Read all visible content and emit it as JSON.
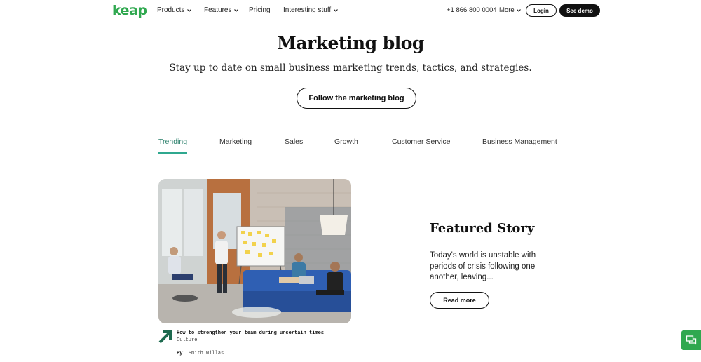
{
  "header": {
    "logo": "keap",
    "nav": [
      {
        "label": "Products",
        "has_dropdown": true
      },
      {
        "label": "Features",
        "has_dropdown": true
      },
      {
        "label": "Pricing",
        "has_dropdown": false
      },
      {
        "label": "Interesting stuff",
        "has_dropdown": true
      }
    ],
    "phone": "+1 866 800 0004",
    "more_label": "More",
    "login_label": "Login",
    "demo_label": "See demo"
  },
  "hero": {
    "title": "Marketing blog",
    "subtitle": "Stay up to date on small business marketing trends, tactics, and strategies.",
    "follow_label": "Follow the marketing blog"
  },
  "tabs": {
    "active": "Trending",
    "items": [
      "Trending",
      "Marketing",
      "Sales",
      "Growth",
      "Customer Service",
      "Business Management"
    ]
  },
  "featured": {
    "heading": "Featured Story",
    "description": "Today's world is unstable with periods of crisis following one another, leaving...",
    "read_more_label": "Read more",
    "post_title": "How to strengthen your team during uncertain times",
    "category": "Culture",
    "author_prefix": "By:",
    "author": "Smith Willas"
  },
  "colors": {
    "brand_green": "#2fa84f",
    "tab_accent": "#2fa88f",
    "text": "#111111",
    "divider": "#b9b9b9"
  },
  "icons": {
    "chevron": "chevron-down-icon",
    "arrow": "arrow-up-right-icon",
    "chat": "chat-icon"
  }
}
